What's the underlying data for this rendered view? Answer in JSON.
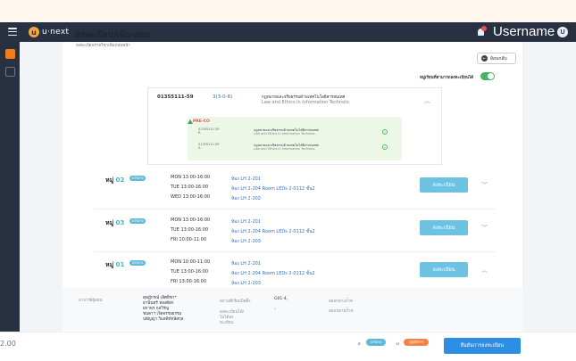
{
  "app": {
    "logo_letter": "u",
    "logo_text": "u·next",
    "username": "Username",
    "avatar_letter": "U"
  },
  "page": {
    "title": "ลงทะเบียน/เพิ่ม-ถอน",
    "subtitle": "ลงทะเบียนรายวิชาเพิ่มก่อนหน้า",
    "back_label": "ย้อนกลับ",
    "toggle_label": "หมู่เรียนที่สามารถลงทะเบียนได้",
    "toggle_on": true
  },
  "subject": {
    "code": "01355111-59",
    "credit": "3(3-0-6)",
    "name_th": "กฎหมายและจริยธรรมด้านเทคโนโลยีสารสนเทศ",
    "name_en": "Law and Ethics in Information Technolo.",
    "prereq_title": "PRE-CO",
    "prereqs": [
      {
        "code": "01355111-59",
        "suffix": "R-",
        "name_th": "กฎหมายและจริยธรรมด้านเทคโนโลยีสารสนเทศ",
        "name_en": "Law and Ethics in Information Technolo."
      },
      {
        "code": "01355111-59",
        "suffix": "A",
        "name_th": "กฎหมายและจริยธรรมด้านเทคโนโลยีสารสนเทศ",
        "name_en": "Law and Ethics in Information Technolo."
      }
    ]
  },
  "sections": [
    {
      "label": "หมู่",
      "num": "02",
      "badge": "บรรยาย",
      "times": [
        "MON 13:00-16:00",
        "TUE 13:00-16:00",
        "WED 13:00-16:00"
      ],
      "rooms": [
        "ห้อง LH 2-201",
        "ห้อง LH 2-204 Room LEDs 2-0112 ชั้น2",
        "ห้อง LH 2-202"
      ],
      "button": "ลงทะเบียน",
      "expanded": false
    },
    {
      "label": "หมู่",
      "num": "03",
      "badge": "บรรยาย",
      "times": [
        "MON 13:00-16:00",
        "TUE 13:00-16:00",
        "FRI 10:00-11:00"
      ],
      "rooms": [
        "ห้อง LH 2-201",
        "ห้อง LH 2-204 Room LEDs 2-0112 ชั้น2",
        "ห้อง LH 2-203"
      ],
      "button": "ลงทะเบียน",
      "expanded": false
    },
    {
      "label": "หมู่",
      "num": "01",
      "badge": "บรรยาย",
      "times": [
        "MON 10:00-11:00",
        "TUE 13:00-16:00",
        "FRI 13:00-16:00"
      ],
      "rooms": [
        "ห้อง LH 2-201",
        "ห้อง LH 2-204 Room LEDs 2-0112 ชั้น2",
        "ห้อง LH 2-203"
      ],
      "button": "ลงทะเบียน",
      "expanded": true
    }
  ],
  "detail": {
    "teacher_label": "อาจารย์ผู้สอน",
    "teachers": [
      "ดุษฎีกรณ์ เลิศทิชา*",
      "ธานินทร์ ทองดีสก",
      "ผกาพร กุลวิรัญ",
      "ชนดาฯ เจิดจรรยธรรม",
      "ปตัญญา วิมลพิทักษ์สกุล"
    ],
    "room_label": "สถานที่เรียนบิลดิ้ง",
    "room_value": "G01-4,",
    "seat_label": "ลงทะเบียนได้/ไม่ได้ลงทะเบียน",
    "seat_value": "-",
    "exam_label": "สอบกลางภาค",
    "exam_value": "-",
    "final_label": "สอบปลายภาค",
    "final_value": "-"
  },
  "footer": {
    "edge_text": "2.00",
    "legend_a": "ส",
    "pill_a": "บรรยาย",
    "legend_b": "ป",
    "pill_b": "ปฏิบัติการ",
    "confirm": "ยืนยันการลงทะเบียน"
  }
}
